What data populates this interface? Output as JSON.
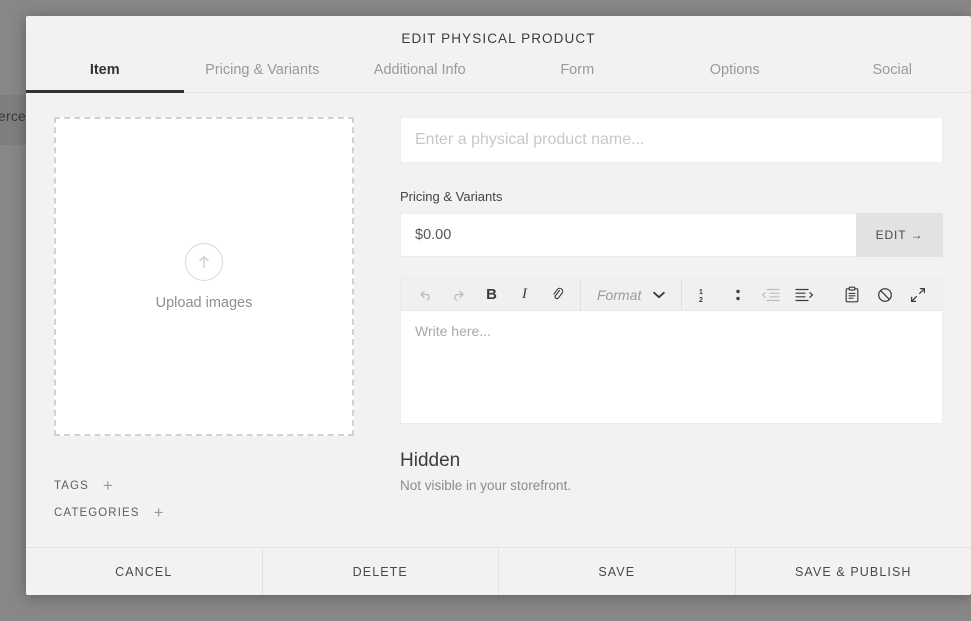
{
  "backdrop": {
    "partial_text": "erce"
  },
  "modal": {
    "title": "EDIT PHYSICAL PRODUCT",
    "tabs": [
      {
        "label": "Item",
        "active": true
      },
      {
        "label": "Pricing & Variants",
        "active": false
      },
      {
        "label": "Additional Info",
        "active": false
      },
      {
        "label": "Form",
        "active": false
      },
      {
        "label": "Options",
        "active": false
      },
      {
        "label": "Social",
        "active": false
      }
    ]
  },
  "uploader": {
    "label": "Upload images",
    "icon": "arrow-up-circle-icon"
  },
  "meta": {
    "tags_label": "TAGS",
    "tags_add": "+",
    "categories_label": "CATEGORIES",
    "categories_add": "+"
  },
  "product": {
    "name_value": "",
    "name_placeholder": "Enter a physical product name..."
  },
  "pricing": {
    "section_label": "Pricing & Variants",
    "price_value": "$0.00",
    "edit_label": "EDIT →"
  },
  "editor": {
    "toolbar": [
      {
        "name": "undo-icon",
        "glyph": "↶",
        "dim": true
      },
      {
        "name": "redo-icon",
        "glyph": "↷",
        "dim": true
      },
      {
        "name": "bold-icon",
        "glyph": "B",
        "dim": false
      },
      {
        "name": "italic-icon",
        "glyph": "I",
        "dim": false
      },
      {
        "name": "link-icon",
        "glyph": "🔗",
        "dim": false
      },
      {
        "name": "numbered-list-icon",
        "glyph": "list-ol",
        "dim": false
      },
      {
        "name": "bullet-list-icon",
        "glyph": "list-ul",
        "dim": false
      },
      {
        "name": "outdent-icon",
        "glyph": "outdent",
        "dim": true
      },
      {
        "name": "indent-icon",
        "glyph": "indent",
        "dim": false
      },
      {
        "name": "paste-icon",
        "glyph": "clipboard",
        "dim": false
      },
      {
        "name": "clear-formatting-icon",
        "glyph": "⊘",
        "dim": false
      },
      {
        "name": "fullscreen-icon",
        "glyph": "expand",
        "dim": false
      }
    ],
    "format_label": "Format",
    "format_chevron": "chevron-down-icon",
    "body_placeholder": "Write here..."
  },
  "visibility": {
    "title": "Hidden",
    "subtitle": "Not visible in your storefront."
  },
  "footer": {
    "buttons": [
      {
        "label": "CANCEL",
        "name": "cancel-button"
      },
      {
        "label": "DELETE",
        "name": "delete-button"
      },
      {
        "label": "SAVE",
        "name": "save-button"
      },
      {
        "label": "SAVE & PUBLISH",
        "name": "save-publish-button"
      }
    ]
  },
  "colors": {
    "modal_bg": "#f2f2f2",
    "accent_underline": "#333333",
    "backdrop": "#878787",
    "field_bg": "#ffffff",
    "edit_button_bg": "#e2e2e2"
  }
}
